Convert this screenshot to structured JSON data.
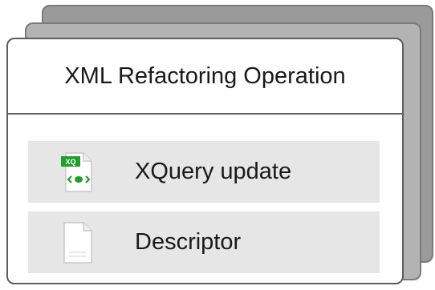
{
  "card": {
    "title": "XML Refactoring Operation"
  },
  "items": [
    {
      "label": "XQuery update",
      "icon": "xquery-file-icon",
      "badge": "XQ"
    },
    {
      "label": "Descriptor",
      "icon": "blank-document-icon"
    }
  ],
  "colors": {
    "shadow_back": "#9a9a9a",
    "shadow_mid": "#b3b3b3",
    "item_background": "#e6e6e6",
    "xquery_badge": "#1fa02a",
    "border": "#5e5e5e"
  }
}
